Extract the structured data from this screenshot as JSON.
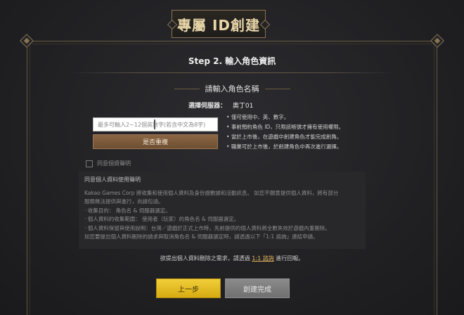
{
  "header": {
    "title": "專屬 ID創建"
  },
  "step": {
    "title": "Step 2. 輸入角色資訊"
  },
  "character": {
    "section_title": "請輸入角色名稱",
    "server_label": "選擇伺服器：",
    "server_value": "奧丁01",
    "name_placeholder": "最多可輸入2~12個英數字(若含中文為8字)",
    "duplicate_check_label": "是否重複",
    "rules": [
      "僅可使用中、英、數字。",
      "事前預約角色 ID，只限該帳號才擁有使用權限。",
      "當於上市後，在遊戲中創建角色才能完成創角。",
      "職業可於上市後，於創建角色中再次進行選擇。"
    ]
  },
  "agreement": {
    "checkbox_label": "同意個資聲明"
  },
  "notice": {
    "heading": "同意個人資料使用聲明",
    "lines": [
      "Kakao Games Corp 將收集和使用個人資料及身份證數據和活動訊息。 如您不願意提供個人資料，將有部分",
      "服務無法提供與進行，尚請包涵。",
      "· 收集目的： 角色名 & 伺服器選定。",
      "· 個人資料的收集範圍： 使用者（玩家）的角色名 & 伺服器選定。",
      "· 個人資料保留與使用說明：台灣／遊戲於正式上市時，先前提供的個人資料將全數失效於遊戲內重刪除。",
      "  如您要提出個人資料刪除的請求與取消角色名 & 伺服器選定時，請透過以下「1:1 諮詢」連結申請。"
    ]
  },
  "contact": {
    "prefix": "欲提出個人資料刪除之需求，請透過",
    "link": "1:1 諮詢",
    "suffix": "進行回報。"
  },
  "buttons": {
    "prev_label": "上一步",
    "done_label": "創建完成"
  },
  "colors": {
    "accent_gold": "#d7ab12",
    "frame_bronze": "#8a7450",
    "link_orange": "#e8b85a"
  }
}
